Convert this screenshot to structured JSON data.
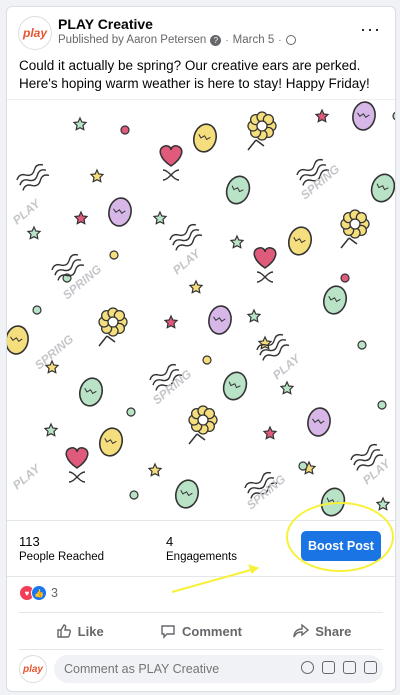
{
  "post": {
    "page_name": "PLAY Creative",
    "logo_text": "play",
    "published_by": "Published by Aaron Petersen",
    "date": "March 5",
    "text": "Could it actually be spring? Our creative ears are perked. Here's hoping warm weather is here to stay! Happy Friday!",
    "more_icon": "···"
  },
  "image": {
    "word_spring": "SPRING",
    "word_play": "PLAY"
  },
  "stats": {
    "reached_value": "113",
    "reached_label": "People Reached",
    "engagements_value": "4",
    "engagements_label": "Engagements",
    "boost_label": "Boost Post"
  },
  "reactions": {
    "count": "3",
    "icons": [
      "love-icon",
      "like-icon"
    ]
  },
  "actions": {
    "like": "Like",
    "comment": "Comment",
    "share": "Share"
  },
  "composer": {
    "placeholder": "Comment as PLAY Creative"
  },
  "colors": {
    "accent": "#1b74e4",
    "highlight": "#f7f13a",
    "egg_green": "#b9e3c6",
    "egg_yellow": "#f5de7d",
    "egg_purple": "#d7b7e8",
    "heart": "#e05a7b"
  }
}
